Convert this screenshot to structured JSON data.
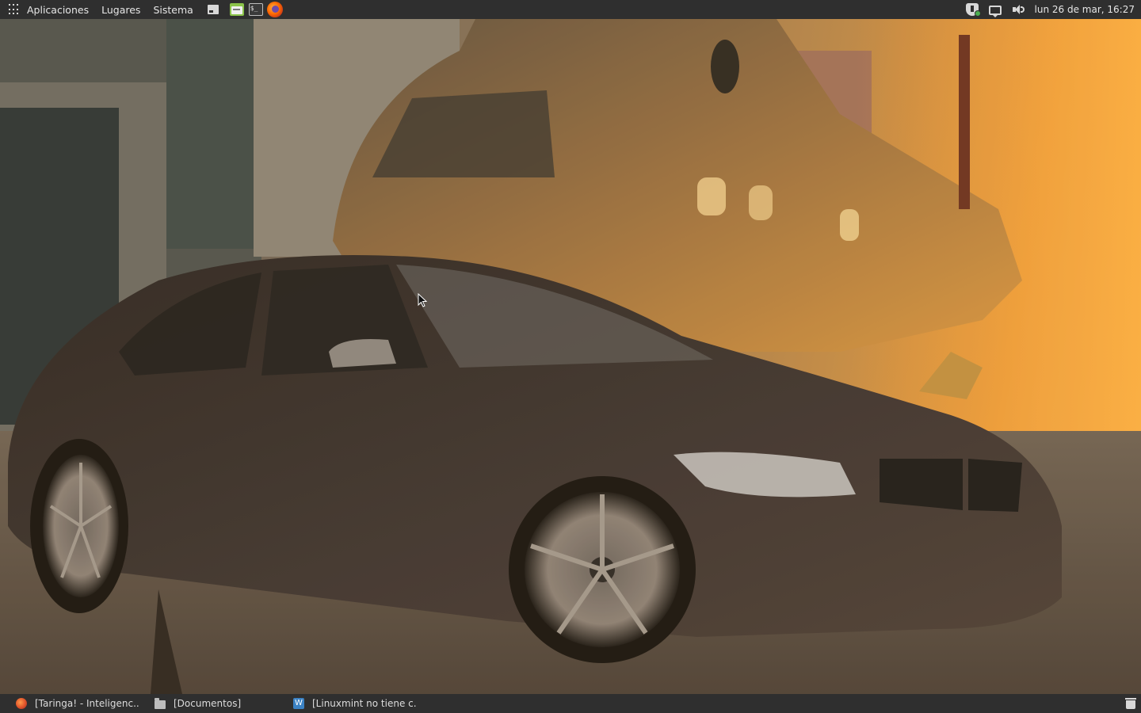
{
  "top_panel": {
    "menus": [
      "Aplicaciones",
      "Lugares",
      "Sistema"
    ],
    "launchers": [
      "show-desktop-icon",
      "file-manager-icon",
      "terminal-icon",
      "firefox-icon"
    ],
    "tray_icons": [
      "update-manager-icon",
      "notifications-icon",
      "volume-icon"
    ],
    "clock": "lun 26 de mar, 16:27"
  },
  "taskbar": {
    "tasks": [
      {
        "label": "[Taringa! - Inteligenc...",
        "icon": "firefox-icon"
      },
      {
        "label": "[Documentos]",
        "icon": "folder-icon"
      },
      {
        "label": "[Linuxmint no tiene c...",
        "icon": "writer-document-icon"
      }
    ],
    "trash_icon": "trash-icon"
  },
  "colors": {
    "panel_bg": "#2f2f2f",
    "panel_text": "#e6e6e6",
    "accent_green": "#8bc34a"
  }
}
